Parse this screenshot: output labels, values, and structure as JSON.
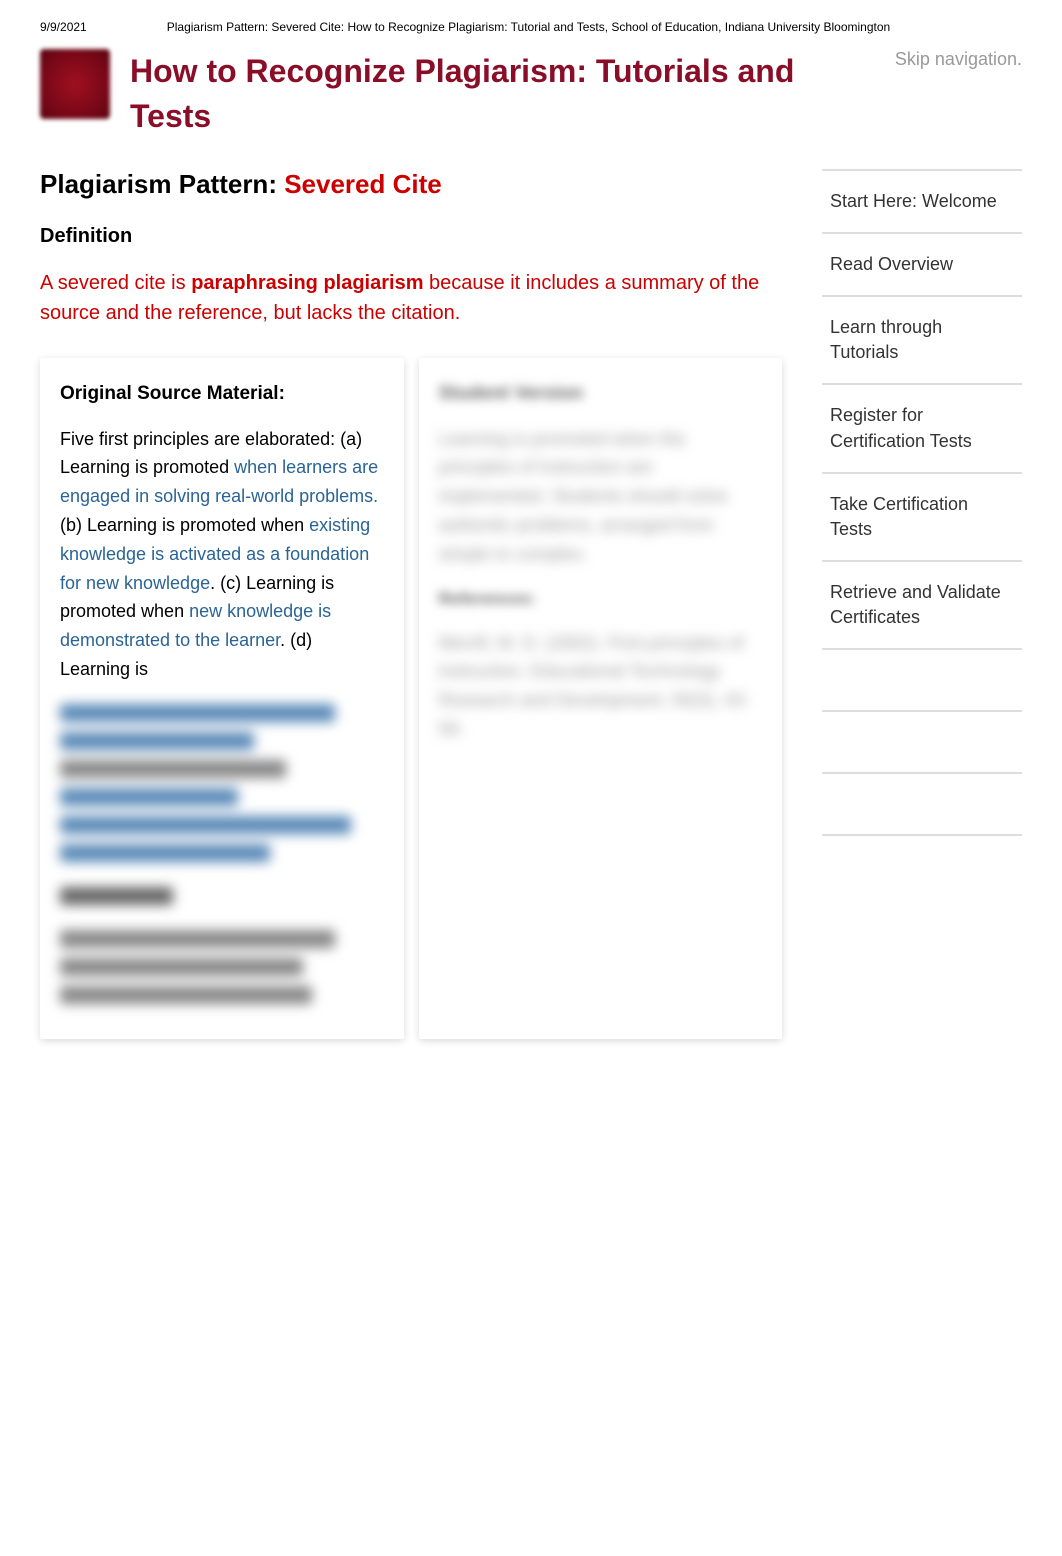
{
  "meta": {
    "date": "9/9/2021",
    "breadcrumb": "Plagiarism Pattern: Severed Cite: How to Recognize Plagiarism: Tutorial and Tests, School of Education, Indiana University Bloomington"
  },
  "header": {
    "title": "How to Recognize Plagiarism: Tutorials and Tests",
    "skip": "Skip navigation."
  },
  "page": {
    "heading_prefix": "Plagiarism Pattern: ",
    "heading_name": "Severed Cite",
    "definition_label": "Definition",
    "definition_pre": "A severed cite is ",
    "definition_bold": "paraphrasing plagiarism",
    "definition_post": " because it includes a summary of the source and the reference, but lacks the citation."
  },
  "original": {
    "title": "Original Source Material:",
    "t1": "Five first principles are elaborated: (a) Learning is promoted ",
    "h1": "when learners are engaged in solving real-world problems.",
    "t2": " (b) Learning is promoted when ",
    "h2": "existing knowledge is activated as a foundation for new knowledge",
    "t3": ". (c) Learning is promoted when ",
    "h3": "new knowledge is demonstrated to the learner",
    "t4": ". (d) Learning is "
  },
  "student": {
    "title": "Student Version",
    "body": "Learning is promoted when the principles of instruction are implemented. Students should solve authentic problems, arranged from simple to complex.",
    "ref_label": "References:",
    "ref": "Merrill, M. D. (2002). First principles of instruction. Educational Technology Research and Development, 50(3), 43-59."
  },
  "sidebar": {
    "items": [
      "Start Here: Welcome",
      "Read Overview",
      "Learn through Tutorials",
      "Register for Certification Tests",
      "Take Certification Tests",
      "Retrieve and Validate Certificates"
    ]
  }
}
